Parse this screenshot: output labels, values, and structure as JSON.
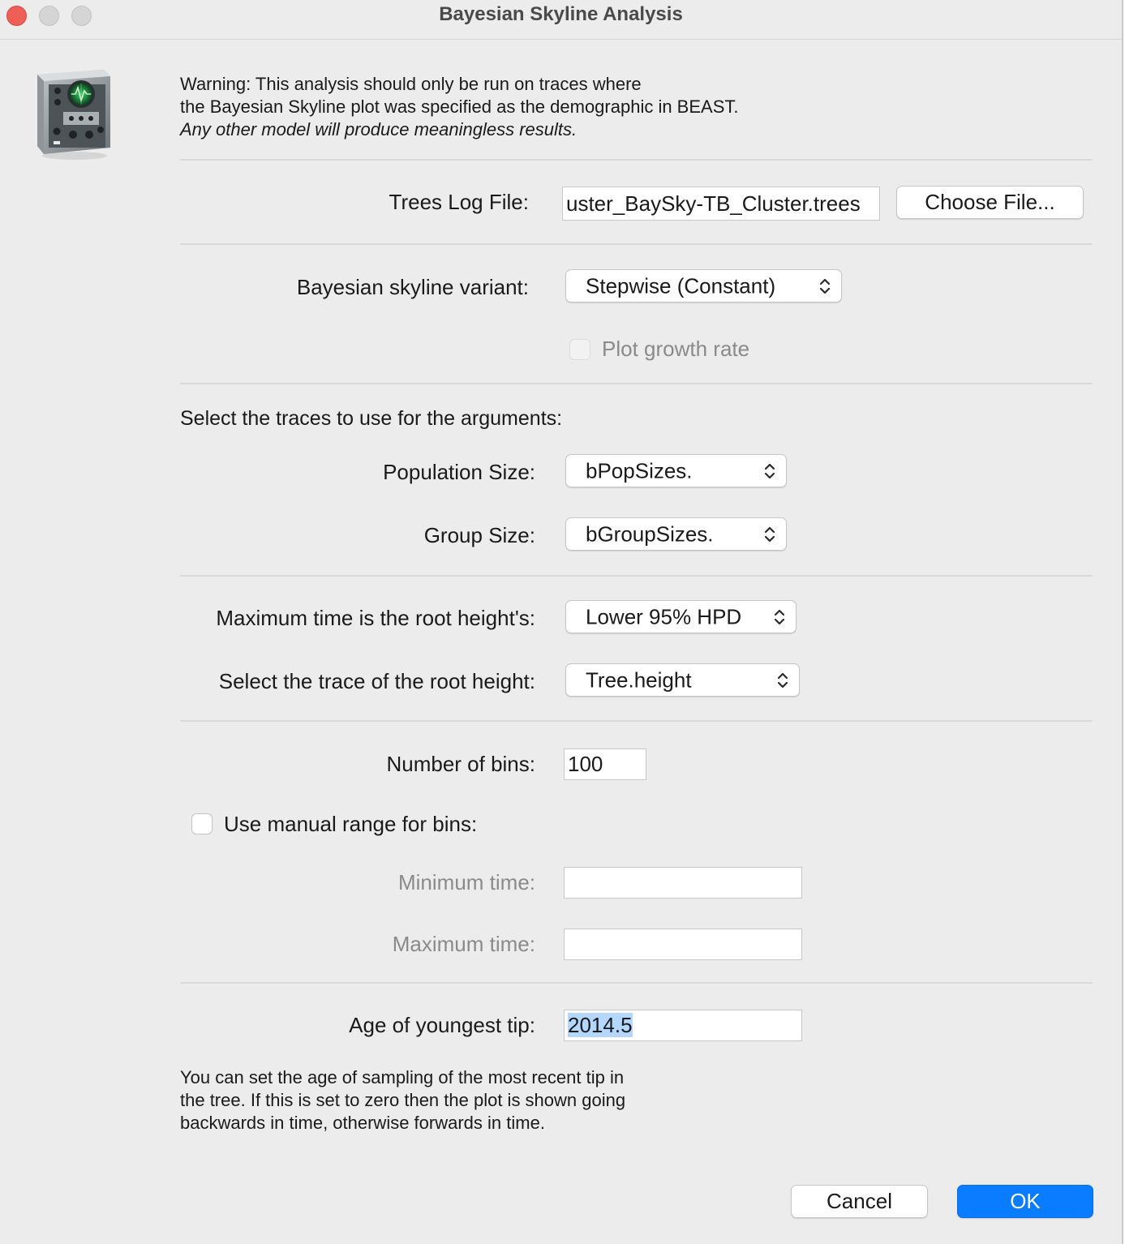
{
  "window": {
    "title": "Bayesian Skyline Analysis"
  },
  "warning": {
    "line1": "Warning: This analysis should only be run on traces where",
    "line2": "the Bayesian Skyline plot was specified as the demographic in BEAST.",
    "line3": "Any other model will produce meaningless results."
  },
  "trees_log": {
    "label": "Trees Log File:",
    "value": "uster_BaySky-TB_Cluster.trees",
    "choose_button": "Choose File..."
  },
  "variant": {
    "label": "Bayesian skyline variant:",
    "selected": "Stepwise (Constant)",
    "growth_rate_label": "Plot growth rate",
    "growth_rate_checked": false,
    "growth_rate_enabled": false
  },
  "traces": {
    "heading": "Select the traces to use for the arguments:",
    "population_label": "Population Size:",
    "population_selected": "bPopSizes.",
    "group_label": "Group Size:",
    "group_selected": "bGroupSizes."
  },
  "root": {
    "max_time_label": "Maximum time is the root height's:",
    "max_time_selected": "Lower 95% HPD",
    "trace_label": "Select the trace of the root height:",
    "trace_selected": "Tree.height"
  },
  "bins": {
    "number_label": "Number of bins:",
    "number_value": "100",
    "manual_label": "Use manual range for bins:",
    "manual_checked": false,
    "min_label": "Minimum time:",
    "min_value": "",
    "max_label": "Maximum time:",
    "max_value": ""
  },
  "tip": {
    "label": "Age of youngest tip:",
    "value": "2014.5",
    "help_line1": "You can set the age of sampling of the most recent tip in",
    "help_line2": "the tree. If this is set to zero then the plot is shown going",
    "help_line3": "backwards in time, otherwise forwards in time."
  },
  "buttons": {
    "cancel": "Cancel",
    "ok": "OK"
  },
  "colors": {
    "accent": "#0a7cff",
    "close": "#ee5f57",
    "selection": "#b3d7ff"
  }
}
